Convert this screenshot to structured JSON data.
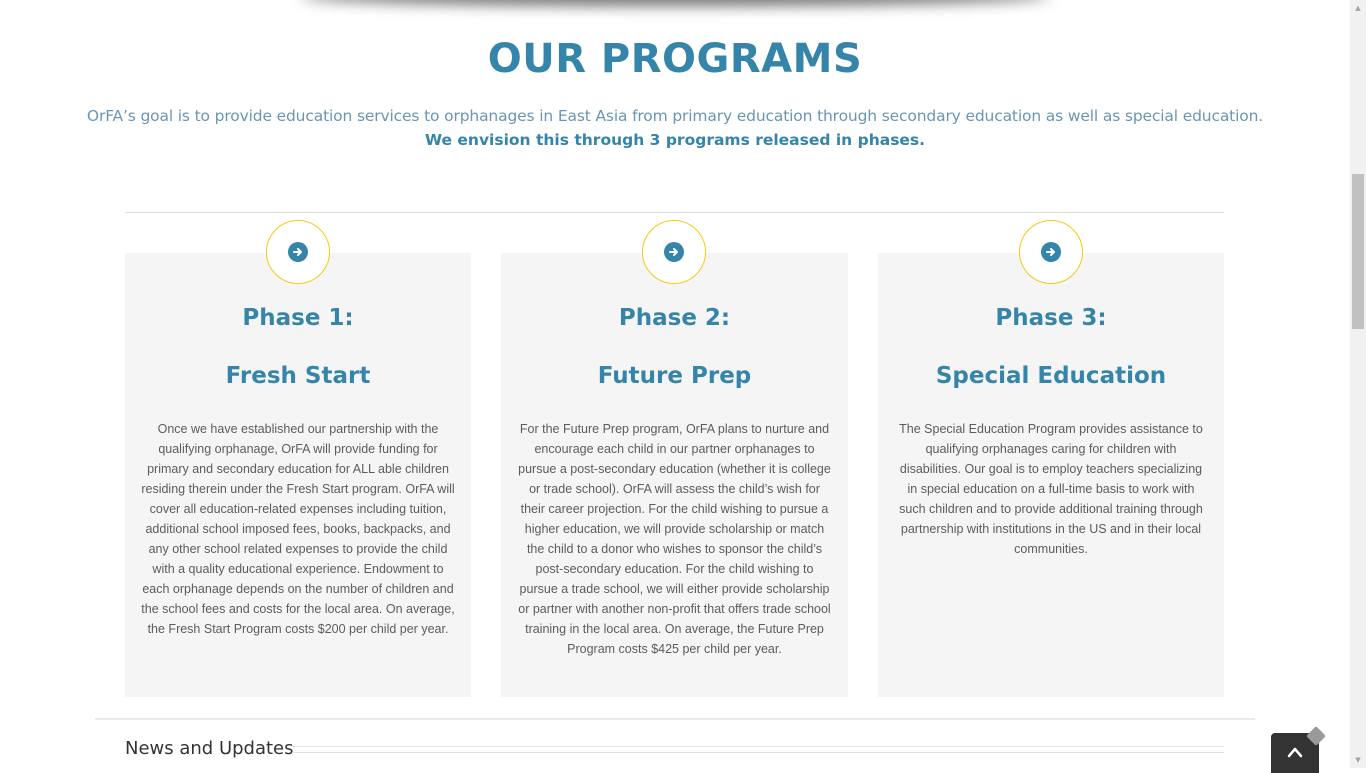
{
  "header": {
    "title": "OUR PROGRAMS",
    "intro_line": "OrFA’s goal is to provide education services to orphanages in East Asia from primary education through secondary education as well as special education.",
    "intro_emphasis": "We envision this through 3 programs released in phases."
  },
  "programs": [
    {
      "icon": "arrow-circle-right-icon",
      "phase": "Phase 1:",
      "name": "Fresh Start",
      "description": "Once we have established our partnership with the qualifying orphanage, OrFA will provide funding for primary and secondary education for ALL able children residing therein under the Fresh Start program. OrFA will cover all education-related expenses including tuition, additional school imposed fees, books, backpacks, and any other school related expenses to provide the child with a quality educational experience. Endowment to each orphanage depends on the number of children and the school fees and costs for the local area. On average, the Fresh Start Program costs $200 per child per year."
    },
    {
      "icon": "arrow-circle-right-icon",
      "phase": "Phase 2:",
      "name": "Future Prep",
      "description": "For the Future Prep program, OrFA plans to nurture and encourage each child in our partner orphanages to pursue a post-secondary education (whether it is college or trade school). OrFA will assess the child’s wish for their career projection. For the child wishing to pursue a higher education, we will provide scholarship or match the child to a donor who wishes to sponsor the child’s post-secondary education. For the child wishing to pursue a trade school, we will either provide scholarship or partner with another non-profit that offers trade school training in the local area. On average, the Future Prep Program costs $425 per child per year."
    },
    {
      "icon": "arrow-circle-right-icon",
      "phase": "Phase 3:",
      "name": "Special Education",
      "description": "The Special Education Program provides assistance to qualifying orphanages caring for children with disabilities. Our goal is to employ teachers specializing in special education on a full-time basis to work with such children and to provide additional training through partnership with institutions in the US and in their local communities."
    }
  ],
  "news": {
    "title": "News and Updates"
  },
  "colors": {
    "accent": "#3585aa",
    "intro_text": "#6a96b3",
    "icon_ring": "#f2cb12",
    "card_bg": "#f5f5f5",
    "body_text": "#5c5c5c"
  },
  "controls": {
    "to_top_icon": "chevron-up-icon",
    "scroll_up_icon": "triangle-up-icon",
    "scroll_down_icon": "triangle-down-icon"
  }
}
